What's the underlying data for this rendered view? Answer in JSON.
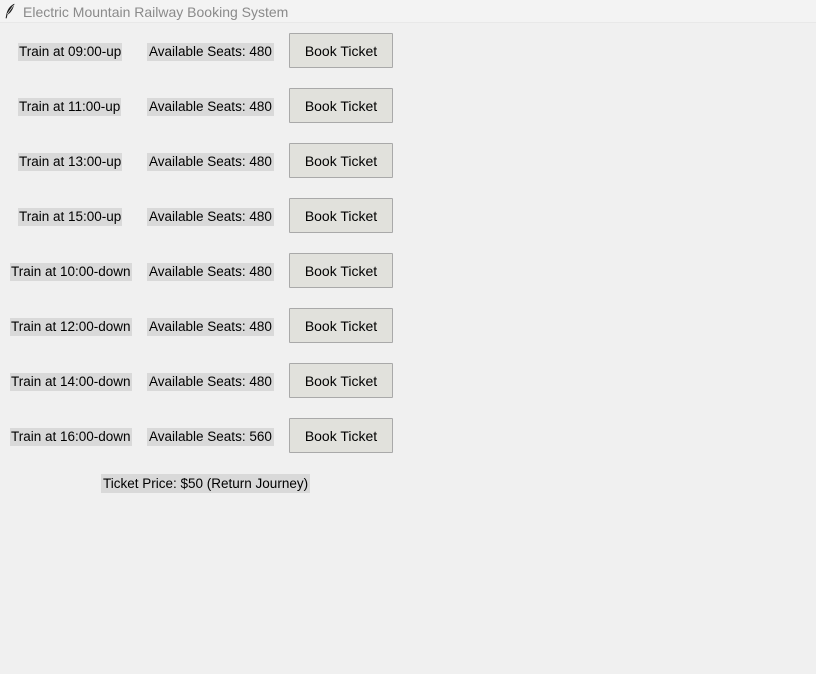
{
  "window": {
    "title": "Electric Mountain Railway Booking System"
  },
  "trains": [
    {
      "label": "Train at 09:00-up",
      "seats": "Available Seats: 480",
      "button": "Book Ticket"
    },
    {
      "label": "Train at 11:00-up",
      "seats": "Available Seats: 480",
      "button": "Book Ticket"
    },
    {
      "label": "Train at 13:00-up",
      "seats": "Available Seats: 480",
      "button": "Book Ticket"
    },
    {
      "label": "Train at 15:00-up",
      "seats": "Available Seats: 480",
      "button": "Book Ticket"
    },
    {
      "label": "Train at 10:00-down",
      "seats": "Available Seats: 480",
      "button": "Book Ticket"
    },
    {
      "label": "Train at 12:00-down",
      "seats": "Available Seats: 480",
      "button": "Book Ticket"
    },
    {
      "label": "Train at 14:00-down",
      "seats": "Available Seats: 480",
      "button": "Book Ticket"
    },
    {
      "label": "Train at 16:00-down",
      "seats": "Available Seats: 560",
      "button": "Book Ticket"
    }
  ],
  "price_label": "Ticket Price: $50 (Return Journey)",
  "icons": {
    "app": "feather-icon"
  },
  "colors": {
    "window_bg": "#f0f0f0",
    "label_bg": "#d9d9d9",
    "button_bg": "#e1e1dc",
    "title_text": "#8a8a8a"
  }
}
